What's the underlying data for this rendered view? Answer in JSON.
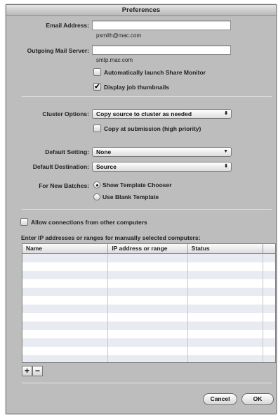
{
  "window": {
    "title": "Preferences"
  },
  "email": {
    "label": "Email Address:",
    "value": "",
    "hint": "psmith@mac.com"
  },
  "mail_server": {
    "label": "Outgoing Mail Server:",
    "value": "",
    "hint": "smtp.mac.com"
  },
  "auto_launch": {
    "label": "Automatically launch Share Monitor",
    "checked": false
  },
  "thumbnails": {
    "label": "Display job thumbnails",
    "checked": true,
    "check_glyph": "✔"
  },
  "cluster": {
    "label": "Cluster Options:",
    "selected": "Copy source to cluster as needed",
    "arrow": "⬍"
  },
  "copy_submission": {
    "label": "Copy at submission (high priority)",
    "checked": false
  },
  "default_setting": {
    "label": "Default Setting:",
    "selected": "None",
    "arrow": "▼"
  },
  "default_destination": {
    "label": "Default Destination:",
    "selected": "Source",
    "arrow": "⬍"
  },
  "new_batches": {
    "label": "For New Batches:",
    "options": [
      "Show Template Chooser",
      "Use Blank Template"
    ],
    "selected_index": 0
  },
  "allow_connections": {
    "label": "Allow connections from other computers",
    "checked": false
  },
  "ip_section": {
    "label": "Enter IP addresses or ranges for manually selected computers:"
  },
  "table": {
    "columns": [
      "Name",
      "IP address or range",
      "Status",
      ""
    ],
    "rows": 13
  },
  "add_button": "+",
  "remove_button": "−",
  "cancel_button": "Cancel",
  "ok_button": "OK",
  "colors": {
    "window_bg": "#bdbdbd",
    "table_stripe": "#e8ecf2"
  }
}
